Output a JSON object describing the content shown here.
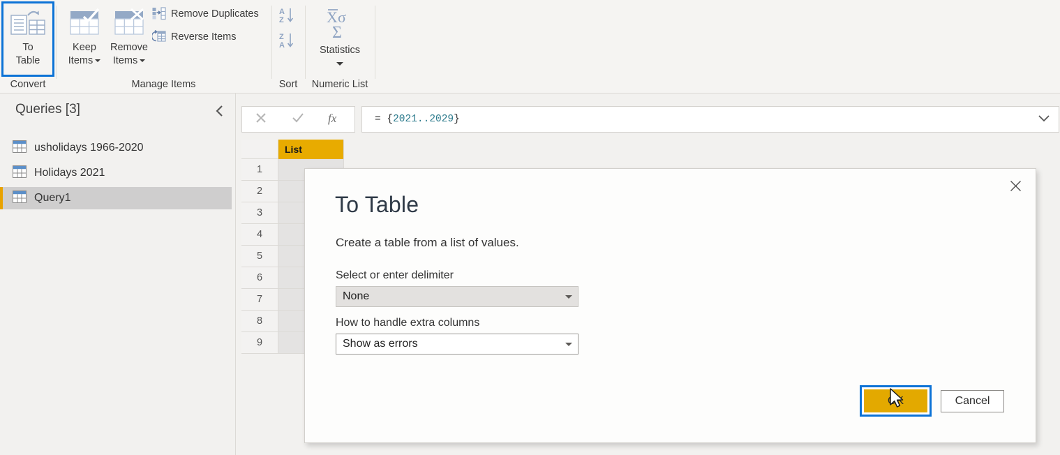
{
  "ribbon": {
    "groups": [
      {
        "label": "Convert"
      },
      {
        "label": "Manage Items"
      },
      {
        "label": "Sort"
      },
      {
        "label": "Numeric List"
      }
    ],
    "to_table": {
      "line1": "To",
      "line2": "Table",
      "icon": "to-table-icon"
    },
    "keep_items": {
      "line1": "Keep",
      "line2": "Items",
      "icon": "keep-items-icon"
    },
    "remove_items": {
      "line1": "Remove",
      "line2": "Items",
      "icon": "remove-items-icon"
    },
    "remove_duplicates": {
      "label": "Remove Duplicates",
      "icon": "remove-duplicates-icon"
    },
    "reverse_items": {
      "label": "Reverse Items",
      "icon": "reverse-items-icon"
    },
    "sort_asc": {
      "icon": "sort-ascending-a-to-z-icon"
    },
    "sort_desc": {
      "icon": "sort-descending-z-to-a-icon"
    },
    "statistics": {
      "label": "Statistics",
      "icon": "statistics-sigma-icon"
    }
  },
  "queries": {
    "title": "Queries [3]",
    "collapse_icon": "chevron-left-icon",
    "items": [
      {
        "label": "usholidays 1966-2020",
        "icon": "table-icon",
        "selected": false
      },
      {
        "label": "Holidays 2021",
        "icon": "table-icon",
        "selected": false
      },
      {
        "label": "Query1",
        "icon": "table-icon",
        "selected": true
      }
    ]
  },
  "formula_bar": {
    "cancel_icon": "cancel-x-icon",
    "accept_icon": "accept-check-icon",
    "fx_icon": "fx-icon",
    "prefix": "= ",
    "expression_start": "{",
    "range": "2021..2029",
    "expression_end": "}",
    "expand_icon": "chevron-down-icon"
  },
  "grid": {
    "column_header": "List",
    "rows": [
      "1",
      "2",
      "3",
      "4",
      "5",
      "6",
      "7",
      "8",
      "9"
    ]
  },
  "dialog": {
    "title": "To Table",
    "subtitle": "Create a table from a list of values.",
    "close_icon": "close-icon",
    "delimiter_label": "Select or enter delimiter",
    "delimiter_value": "None",
    "extra_columns_label": "How to handle extra columns",
    "extra_columns_value": "Show as errors",
    "ok_label": "OK",
    "cancel_label": "Cancel",
    "dropdown_icon": "chevron-down-icon",
    "cursor_icon": "mouse-pointer-icon"
  },
  "colors": {
    "focus_blue": "#0c72d6",
    "accent_gold": "#e3a900",
    "header_gold": "#e8ab00",
    "selection_gray": "#cfcece",
    "formula_number": "#2b7a8c"
  }
}
